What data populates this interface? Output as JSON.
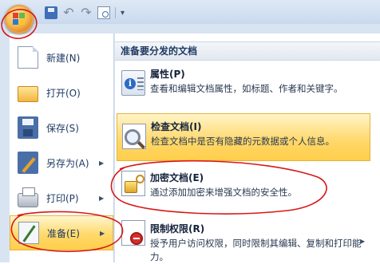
{
  "quick_access": {
    "save_icon": "save-icon",
    "undo_glyph": "↶",
    "redo_glyph": "↷",
    "customize_glyph": "▾"
  },
  "left_menu": {
    "items": [
      {
        "label": "新建(N)",
        "icon": "new-document-icon",
        "has_submenu": false,
        "active": false
      },
      {
        "label": "打开(O)",
        "icon": "open-folder-icon",
        "has_submenu": false,
        "active": false
      },
      {
        "label": "保存(S)",
        "icon": "save-disk-icon",
        "has_submenu": false,
        "active": false
      },
      {
        "label": "另存为(A)",
        "icon": "save-as-icon",
        "has_submenu": true,
        "active": false
      },
      {
        "label": "打印(P)",
        "icon": "printer-icon",
        "has_submenu": true,
        "active": false
      },
      {
        "label": "准备(E)",
        "icon": "prepare-icon",
        "has_submenu": true,
        "active": true
      }
    ],
    "submenu_arrow": "▶"
  },
  "right_panel": {
    "header": "准备要分发的文档",
    "options": [
      {
        "title": "属性(P)",
        "description": "查看和编辑文档属性，如标题、作者和关键字。",
        "icon": "properties-icon",
        "highlight": false,
        "has_submenu": false
      },
      {
        "title": "检查文档(I)",
        "description": "检查文档中是否有隐藏的元数据或个人信息。",
        "icon": "inspect-document-icon",
        "highlight": true,
        "has_submenu": false
      },
      {
        "title": "加密文档(E)",
        "description": "通过添加加密来增强文档的安全性。",
        "icon": "encrypt-document-icon",
        "highlight": false,
        "has_submenu": false
      },
      {
        "title": "限制权限(R)",
        "description": "授予用户访问权限，同时限制其编辑、复制和打印能力。",
        "icon": "restrict-permission-icon",
        "highlight": false,
        "has_submenu": true
      }
    ]
  },
  "colors": {
    "highlight_gold": "#ffd768",
    "annotation_red": "#d81818",
    "menu_text": "#1f3a63"
  }
}
